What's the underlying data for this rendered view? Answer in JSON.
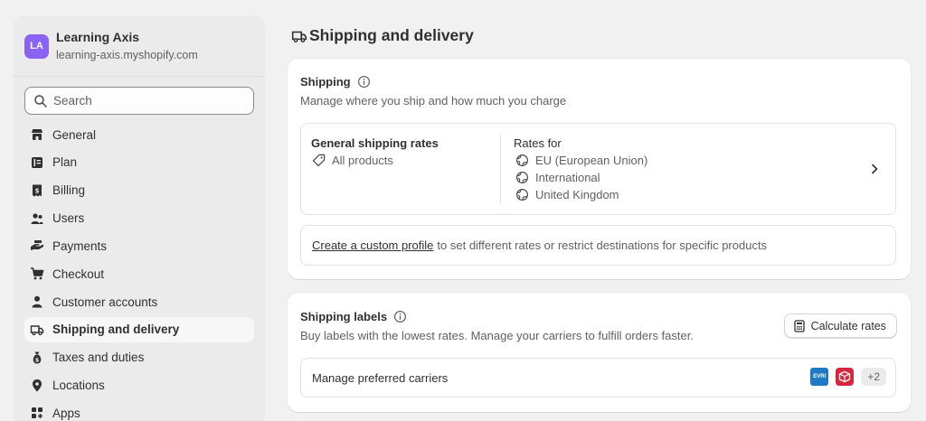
{
  "store": {
    "avatar_initials": "LA",
    "name": "Learning Axis",
    "domain": "learning-axis.myshopify.com",
    "avatar_color": "#8a63f2"
  },
  "search": {
    "placeholder": "Search"
  },
  "nav": {
    "items": [
      {
        "label": "General",
        "icon": "store-icon"
      },
      {
        "label": "Plan",
        "icon": "plan-icon"
      },
      {
        "label": "Billing",
        "icon": "billing-icon"
      },
      {
        "label": "Users",
        "icon": "users-icon"
      },
      {
        "label": "Payments",
        "icon": "payments-icon"
      },
      {
        "label": "Checkout",
        "icon": "cart-icon"
      },
      {
        "label": "Customer accounts",
        "icon": "person-icon"
      },
      {
        "label": "Shipping and delivery",
        "icon": "truck-icon",
        "active": true
      },
      {
        "label": "Taxes and duties",
        "icon": "money-bag-icon"
      },
      {
        "label": "Locations",
        "icon": "location-pin-icon"
      },
      {
        "label": "Apps",
        "icon": "apps-icon"
      }
    ]
  },
  "page": {
    "title": "Shipping and delivery",
    "title_icon": "truck-icon"
  },
  "shipping": {
    "title": "Shipping",
    "subtitle": "Manage where you ship and how much you charge",
    "rates_title": "General shipping rates",
    "products_label": "All products",
    "rates_for_label": "Rates for",
    "zones": [
      "EU (European Union)",
      "International",
      "United Kingdom"
    ],
    "custom_profile_link": "Create a custom profile",
    "custom_profile_text": "to set different rates or restrict destinations for specific products"
  },
  "labels": {
    "title": "Shipping labels",
    "subtitle": "Buy labels with the lowest rates. Manage your carriers to fulfill orders faster.",
    "calculate_button": "Calculate rates",
    "manage_carriers": "Manage preferred carriers",
    "carrier_logo_text": "EVRI",
    "more_carriers": "+2"
  },
  "colors": {
    "accent_avatar": "#8a63f2",
    "carrier_blue": "#1f7ac4",
    "carrier_red": "#d7263d"
  }
}
